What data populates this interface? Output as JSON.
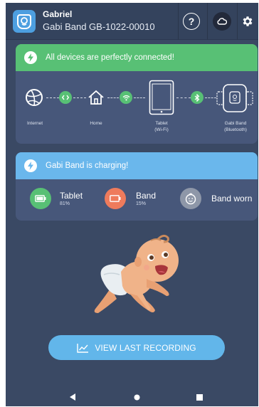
{
  "header": {
    "user_name": "Gabriel",
    "device_id": "Gabi Band GB-1022-00010",
    "help_glyph": "?",
    "logo_icon": "gabi-face-icon",
    "cloud_icon": "cloud-icon",
    "settings_icon": "gear-icon"
  },
  "connection": {
    "banner": "All devices are perfectly connected!",
    "nodes": [
      {
        "label": "Internet",
        "icon": "globe-icon"
      },
      {
        "label": "Home",
        "icon": "home-icon"
      },
      {
        "label": "Tablet\n(Wi-Fi)",
        "icon": "tablet-icon"
      },
      {
        "label": "Gabi Band\n(Bluetooth)",
        "icon": "band-icon"
      }
    ],
    "links": [
      "code-link-icon",
      "wifi-icon",
      "bluetooth-icon"
    ]
  },
  "charging": {
    "banner": "Gabi Band is charging!",
    "items": [
      {
        "name": "Tablet",
        "value": "81%",
        "color": "#58c075",
        "icon": "battery-full-icon"
      },
      {
        "name": "Band",
        "value": "15%",
        "color": "#ee7b5c",
        "icon": "battery-low-icon"
      },
      {
        "name": "Band worn",
        "value": "",
        "color": "#8e97a8",
        "icon": "baby-face-icon"
      }
    ]
  },
  "actions": {
    "view_last_recording": "VIEW LAST RECORDING"
  },
  "colors": {
    "background": "#3a4964",
    "card": "#47577a",
    "success": "#58c075",
    "info": "#6ab7ec",
    "warning": "#ee7b5c"
  }
}
